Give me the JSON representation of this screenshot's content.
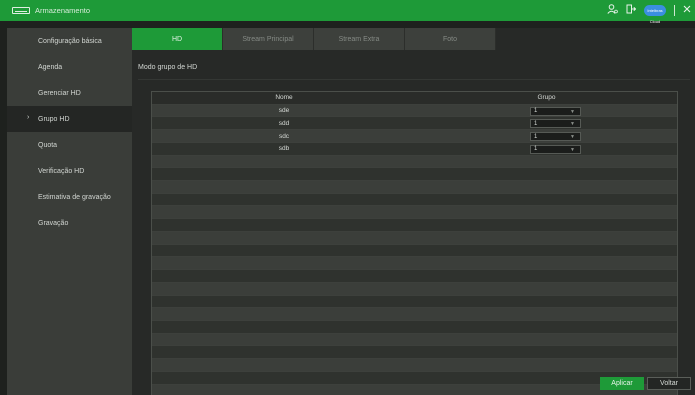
{
  "window": {
    "title": "Armazenamento",
    "icons": [
      "storage-icon",
      "user-icon",
      "logout-icon",
      "cloud-icon",
      "close-icon"
    ],
    "cloud_text": "Intelbras Cloud",
    "accent_color": "#1e9a38"
  },
  "sidebar": {
    "items": [
      {
        "label": "Configuração básica"
      },
      {
        "label": "Agenda"
      },
      {
        "label": "Gerenciar HD"
      },
      {
        "label": "Grupo HD",
        "active": true
      },
      {
        "label": "Quota"
      },
      {
        "label": "Verificação HD"
      },
      {
        "label": "Estimativa de gravação"
      },
      {
        "label": "Gravação"
      }
    ],
    "active_arrow": "›"
  },
  "tabs": [
    {
      "label": "HD",
      "active": true
    },
    {
      "label": "Stream Principal"
    },
    {
      "label": "Stream Extra"
    },
    {
      "label": "Foto"
    }
  ],
  "main": {
    "mode_label": "Modo grupo de HD"
  },
  "table": {
    "headers": {
      "name": "Nome",
      "group": "Grupo"
    },
    "rows": [
      {
        "name": "sde",
        "group": "1"
      },
      {
        "name": "sdd",
        "group": "1"
      },
      {
        "name": "sdc",
        "group": "1"
      },
      {
        "name": "sdb",
        "group": "1"
      }
    ]
  },
  "buttons": {
    "apply": "Aplicar",
    "back": "Voltar"
  }
}
